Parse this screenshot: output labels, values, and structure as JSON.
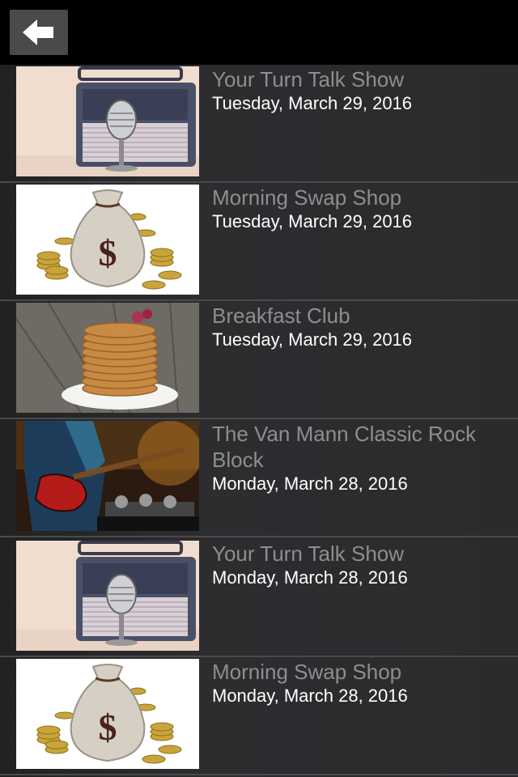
{
  "header": {
    "back_icon": "back-arrow-icon"
  },
  "items": [
    {
      "title": "Your Turn Talk Show",
      "date": "Tuesday, March 29, 2016",
      "thumbnail": "radio-microphone"
    },
    {
      "title": "Morning Swap Shop",
      "date": "Tuesday, March 29, 2016",
      "thumbnail": "money-bag"
    },
    {
      "title": "Breakfast Club",
      "date": "Tuesday, March 29, 2016",
      "thumbnail": "pancakes"
    },
    {
      "title": "The Van Mann Classic Rock Block",
      "date": "Monday, March 28, 2016",
      "thumbnail": "guitarist"
    },
    {
      "title": "Your Turn Talk Show",
      "date": "Monday, March 28, 2016",
      "thumbnail": "radio-microphone"
    },
    {
      "title": "Morning Swap Shop",
      "date": "Monday, March 28, 2016",
      "thumbnail": "money-bag"
    }
  ]
}
